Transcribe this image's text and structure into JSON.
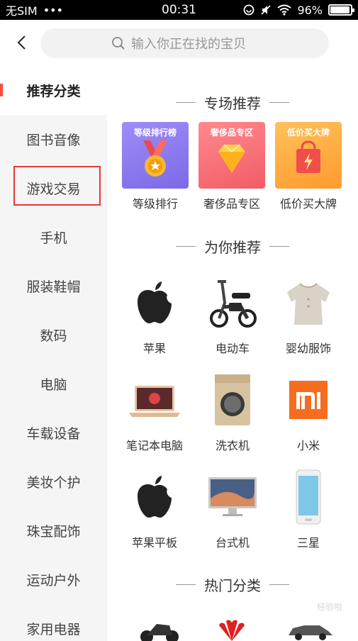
{
  "status_bar": {
    "carrier": "无SIM",
    "dots": "•••",
    "time": "00:31",
    "battery": "96%",
    "battery_level": 0.96
  },
  "header": {
    "search_placeholder": "输入你正在找的宝贝"
  },
  "sidebar": {
    "items": [
      {
        "label": "推荐分类",
        "active": true
      },
      {
        "label": "图书音像"
      },
      {
        "label": "游戏交易",
        "highlighted": true
      },
      {
        "label": "手机"
      },
      {
        "label": "服装鞋帽"
      },
      {
        "label": "数码"
      },
      {
        "label": "电脑"
      },
      {
        "label": "车载设备"
      },
      {
        "label": "美妆个护"
      },
      {
        "label": "珠宝配饰"
      },
      {
        "label": "运动户外"
      },
      {
        "label": "家用电器"
      }
    ]
  },
  "sections": {
    "special": "专场推荐",
    "for_you": "为你推荐",
    "hot": "热门分类"
  },
  "promos": [
    {
      "card_title": "等级排行榜",
      "label": "等级排行",
      "color": "#8b7cf0"
    },
    {
      "card_title": "奢侈品专区",
      "label": "奢侈品专区",
      "color": "#f46a6f"
    },
    {
      "card_title": "低价买大牌",
      "label": "低价买大牌",
      "color": "#ff9f3d"
    }
  ],
  "recommend": [
    {
      "label": "苹果",
      "icon": "apple-icon"
    },
    {
      "label": "电动车",
      "icon": "ebike-icon"
    },
    {
      "label": "婴幼服饰",
      "icon": "baby-clothes-icon"
    },
    {
      "label": "笔记本电脑",
      "icon": "laptop-icon"
    },
    {
      "label": "洗衣机",
      "icon": "washing-machine-icon"
    },
    {
      "label": "小米",
      "icon": "xiaomi-icon"
    },
    {
      "label": "苹果平板",
      "icon": "apple-icon"
    },
    {
      "label": "台式机",
      "icon": "desktop-icon"
    },
    {
      "label": "三星",
      "icon": "phone-icon"
    }
  ],
  "colors": {
    "accent": "#ff4a3d",
    "highlight_border": "#e53935",
    "xiaomi": "#f56d1f"
  },
  "watermark": "经验啦"
}
